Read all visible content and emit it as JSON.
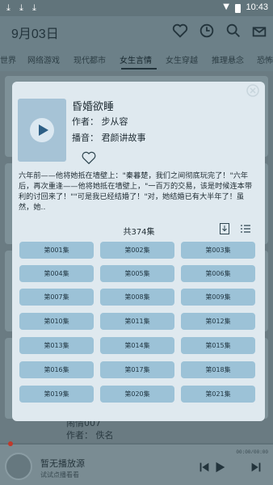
{
  "status_bar": {
    "time": "10:43"
  },
  "header": {
    "date": "9月03日",
    "icons": [
      "heart-icon",
      "clock-icon",
      "search-icon",
      "mail-icon"
    ]
  },
  "categories": [
    "世界",
    "网络游戏",
    "现代都市",
    "女生言情",
    "女生穿越",
    "推理悬念",
    "恐怖"
  ],
  "active_category": "女生言情",
  "background_list": {
    "peek_title": "闹情007",
    "peek_author": "作者：  佚名"
  },
  "player": {
    "title": "暂无播放源",
    "subtitle": "试试点播看看",
    "time": "00:00/00:00"
  },
  "modal": {
    "title": "昏婚欲睡",
    "author": "作者：  步从容",
    "narrator": "播音：  君颜讲故事",
    "description": "六年前——他将她抵在墙壁上：\"秦暮楚，我们之间彻底玩完了！\"六年后，再次重逢——他将她抵在墙壁上，\"一百万的交易，该是时候连本带利的讨回来了！\"\"可是我已经结婚了！\"对，她结婚已有大半年了！虽然，她..",
    "episode_count": "共374集",
    "episodes": [
      "第001集",
      "第002集",
      "第003集",
      "第004集",
      "第005集",
      "第006集",
      "第007集",
      "第008集",
      "第009集",
      "第010集",
      "第011集",
      "第012集",
      "第013集",
      "第014集",
      "第015集",
      "第016集",
      "第017集",
      "第018集",
      "第019集",
      "第020集",
      "第021集"
    ]
  },
  "colors": {
    "modal_bg": "#dfe9ef",
    "episode_button": "#9cc2d7",
    "overlay": "#6e7f86"
  }
}
